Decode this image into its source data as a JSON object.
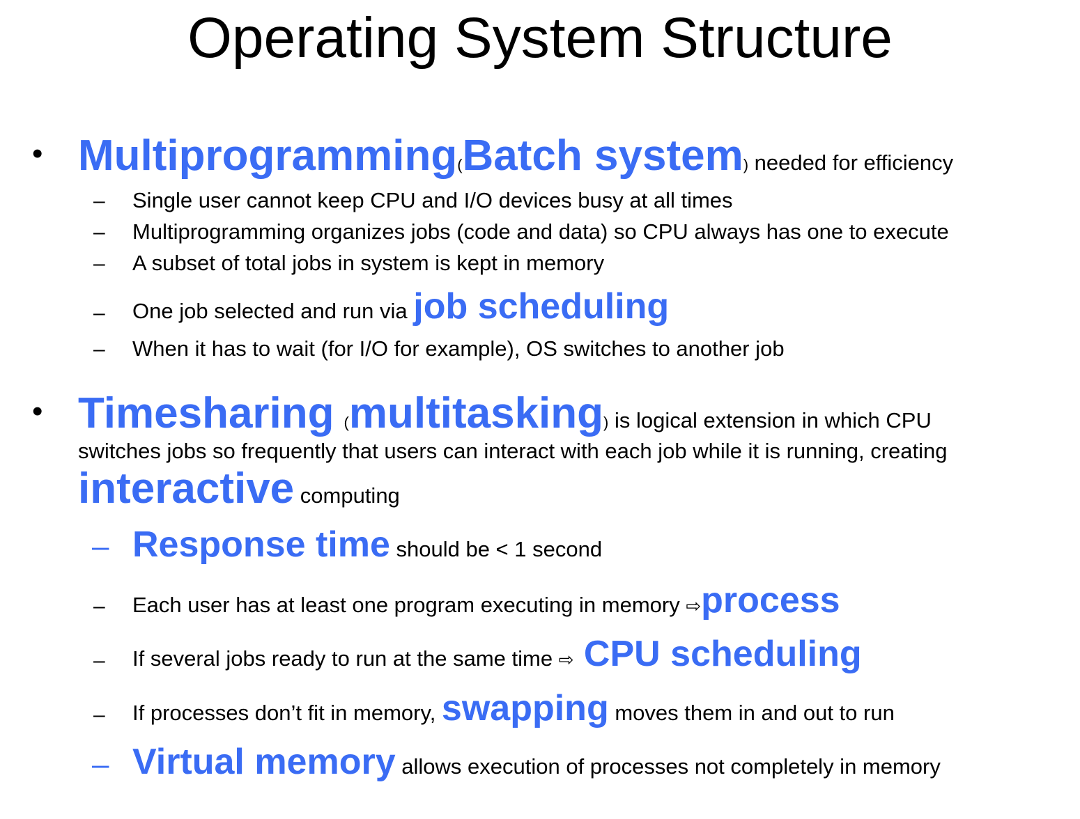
{
  "slide": {
    "title": "Operating System Structure",
    "accent_color": "#3a6cf4",
    "bullet1": {
      "term": "Multiprogramming",
      "open_paren": "(",
      "term2": "Batch system",
      "close_paren": ")",
      "rest": " needed for efficiency",
      "sub": [
        "Single user cannot keep CPU and I/O devices busy at all times",
        "Multiprogramming organizes jobs (code and data) so CPU always has one to execute",
        "A subset of total jobs in system is kept in memory"
      ],
      "sub4_text": "One job selected and run via ",
      "sub4_term": "job scheduling",
      "sub5": "When it has to wait (for I/O for example), OS switches to another job"
    },
    "bullet2": {
      "term": "Timesharing",
      "open_paren": "(",
      "term2": "multitasking",
      "close_paren": ")",
      "rest": "  is logical extension in which CPU",
      "line2": "switches jobs so frequently that users can interact with each job while it is running, creating",
      "term3": "interactive",
      "line3_rest": " computing",
      "s1_term": "Response time",
      "s1_rest": " should be < 1 second",
      "s2_text": "Each user has at least one program executing in memory ",
      "s2_arrow": "⇨",
      "s2_term": "process",
      "s3_text": "If several jobs ready to run at the same time ",
      "s3_arrow": "⇨",
      "s3_term": " CPU scheduling",
      "s4_text": "If processes don’t fit in memory, ",
      "s4_term": "swapping",
      "s4_rest": " moves them in and out to run",
      "s5_term": "Virtual memory",
      "s5_rest": " allows execution of processes not completely in memory"
    },
    "dash": "–",
    "bullet_char": "•"
  }
}
